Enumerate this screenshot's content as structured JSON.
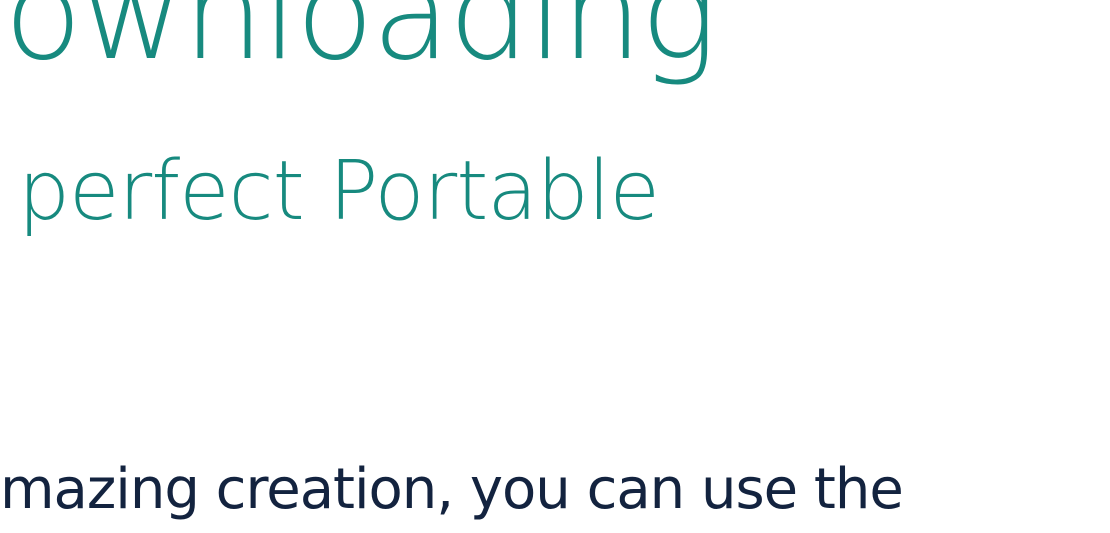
{
  "content": {
    "headline": "ownloading",
    "subheadline": "perfect Portable",
    "body_text": "mazing creation, you can use the"
  },
  "colors": {
    "headline": "#178a7f",
    "body_text": "#13233f",
    "background": "#ffffff"
  }
}
